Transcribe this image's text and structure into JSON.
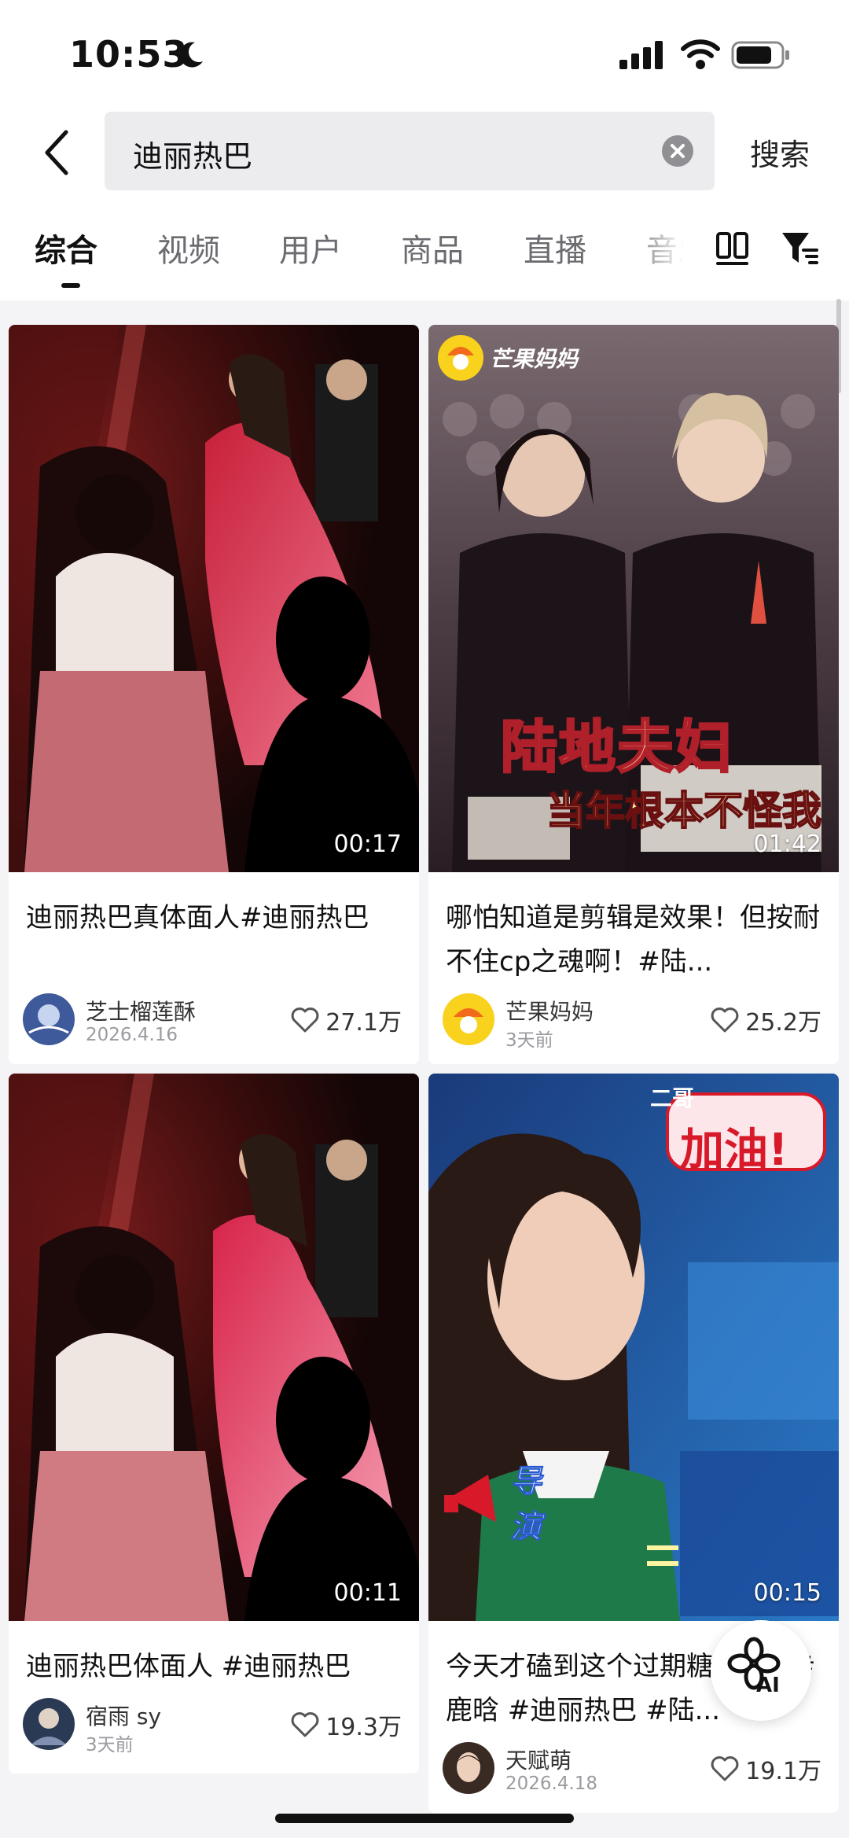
{
  "status_bar": {
    "time": "10:53"
  },
  "search": {
    "query": "迪丽热巴",
    "submit_label": "搜索"
  },
  "tabs": [
    {
      "label": "综合",
      "active": true
    },
    {
      "label": "视频"
    },
    {
      "label": "用户"
    },
    {
      "label": "商品"
    },
    {
      "label": "直播"
    },
    {
      "label": "音乐"
    }
  ],
  "results": [
    {
      "duration": "00:17",
      "title": "迪丽热巴真体面人#迪丽热巴",
      "author": "芝士榴莲酥",
      "date": "2026.4.16",
      "likes": "27.1万"
    },
    {
      "duration": "01:42",
      "title": "哪怕知道是剪辑是效果！但按耐不住cp之魂啊！#陆...",
      "author": "芒果妈妈",
      "date": "3天前",
      "likes": "25.2万",
      "watermark": "芒果妈妈",
      "caption_main": "陆地夫妇",
      "caption_sub": "当年根本不怪我"
    },
    {
      "duration": "00:11",
      "title": "迪丽热巴体面人 #迪丽热巴",
      "author": "宿雨 sy",
      "date": "3天前",
      "likes": "19.3万"
    },
    {
      "duration": "00:15",
      "title": "今天才磕到这个过期糖！！！#鹿晗 #迪丽热巴 #陆...",
      "author": "天赋萌",
      "date": "2026.4.18",
      "likes": "19.1万",
      "bubble_label": "二哥",
      "bubble_text": "加油!",
      "tag": "导演"
    }
  ],
  "ai_button": {
    "label": "AI"
  },
  "colors": {
    "accent": "#111111",
    "muted": "#6b6b70",
    "background": "#f4f4f6"
  }
}
